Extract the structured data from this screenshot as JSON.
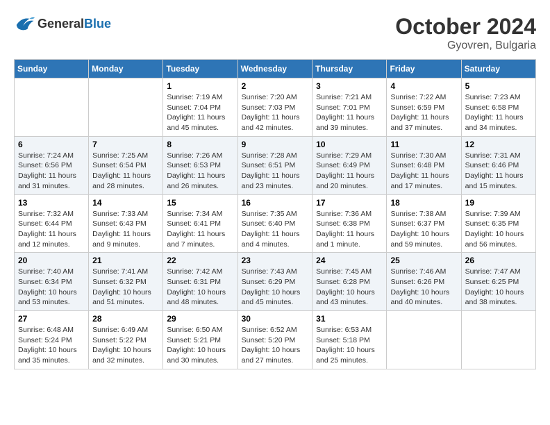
{
  "header": {
    "logo_general": "General",
    "logo_blue": "Blue",
    "month_year": "October 2024",
    "location": "Gyovren, Bulgaria"
  },
  "weekdays": [
    "Sunday",
    "Monday",
    "Tuesday",
    "Wednesday",
    "Thursday",
    "Friday",
    "Saturday"
  ],
  "weeks": [
    [
      {
        "day": "",
        "sunrise": "",
        "sunset": "",
        "daylight": ""
      },
      {
        "day": "",
        "sunrise": "",
        "sunset": "",
        "daylight": ""
      },
      {
        "day": "1",
        "sunrise": "Sunrise: 7:19 AM",
        "sunset": "Sunset: 7:04 PM",
        "daylight": "Daylight: 11 hours and 45 minutes."
      },
      {
        "day": "2",
        "sunrise": "Sunrise: 7:20 AM",
        "sunset": "Sunset: 7:03 PM",
        "daylight": "Daylight: 11 hours and 42 minutes."
      },
      {
        "day": "3",
        "sunrise": "Sunrise: 7:21 AM",
        "sunset": "Sunset: 7:01 PM",
        "daylight": "Daylight: 11 hours and 39 minutes."
      },
      {
        "day": "4",
        "sunrise": "Sunrise: 7:22 AM",
        "sunset": "Sunset: 6:59 PM",
        "daylight": "Daylight: 11 hours and 37 minutes."
      },
      {
        "day": "5",
        "sunrise": "Sunrise: 7:23 AM",
        "sunset": "Sunset: 6:58 PM",
        "daylight": "Daylight: 11 hours and 34 minutes."
      }
    ],
    [
      {
        "day": "6",
        "sunrise": "Sunrise: 7:24 AM",
        "sunset": "Sunset: 6:56 PM",
        "daylight": "Daylight: 11 hours and 31 minutes."
      },
      {
        "day": "7",
        "sunrise": "Sunrise: 7:25 AM",
        "sunset": "Sunset: 6:54 PM",
        "daylight": "Daylight: 11 hours and 28 minutes."
      },
      {
        "day": "8",
        "sunrise": "Sunrise: 7:26 AM",
        "sunset": "Sunset: 6:53 PM",
        "daylight": "Daylight: 11 hours and 26 minutes."
      },
      {
        "day": "9",
        "sunrise": "Sunrise: 7:28 AM",
        "sunset": "Sunset: 6:51 PM",
        "daylight": "Daylight: 11 hours and 23 minutes."
      },
      {
        "day": "10",
        "sunrise": "Sunrise: 7:29 AM",
        "sunset": "Sunset: 6:49 PM",
        "daylight": "Daylight: 11 hours and 20 minutes."
      },
      {
        "day": "11",
        "sunrise": "Sunrise: 7:30 AM",
        "sunset": "Sunset: 6:48 PM",
        "daylight": "Daylight: 11 hours and 17 minutes."
      },
      {
        "day": "12",
        "sunrise": "Sunrise: 7:31 AM",
        "sunset": "Sunset: 6:46 PM",
        "daylight": "Daylight: 11 hours and 15 minutes."
      }
    ],
    [
      {
        "day": "13",
        "sunrise": "Sunrise: 7:32 AM",
        "sunset": "Sunset: 6:44 PM",
        "daylight": "Daylight: 11 hours and 12 minutes."
      },
      {
        "day": "14",
        "sunrise": "Sunrise: 7:33 AM",
        "sunset": "Sunset: 6:43 PM",
        "daylight": "Daylight: 11 hours and 9 minutes."
      },
      {
        "day": "15",
        "sunrise": "Sunrise: 7:34 AM",
        "sunset": "Sunset: 6:41 PM",
        "daylight": "Daylight: 11 hours and 7 minutes."
      },
      {
        "day": "16",
        "sunrise": "Sunrise: 7:35 AM",
        "sunset": "Sunset: 6:40 PM",
        "daylight": "Daylight: 11 hours and 4 minutes."
      },
      {
        "day": "17",
        "sunrise": "Sunrise: 7:36 AM",
        "sunset": "Sunset: 6:38 PM",
        "daylight": "Daylight: 11 hours and 1 minute."
      },
      {
        "day": "18",
        "sunrise": "Sunrise: 7:38 AM",
        "sunset": "Sunset: 6:37 PM",
        "daylight": "Daylight: 10 hours and 59 minutes."
      },
      {
        "day": "19",
        "sunrise": "Sunrise: 7:39 AM",
        "sunset": "Sunset: 6:35 PM",
        "daylight": "Daylight: 10 hours and 56 minutes."
      }
    ],
    [
      {
        "day": "20",
        "sunrise": "Sunrise: 7:40 AM",
        "sunset": "Sunset: 6:34 PM",
        "daylight": "Daylight: 10 hours and 53 minutes."
      },
      {
        "day": "21",
        "sunrise": "Sunrise: 7:41 AM",
        "sunset": "Sunset: 6:32 PM",
        "daylight": "Daylight: 10 hours and 51 minutes."
      },
      {
        "day": "22",
        "sunrise": "Sunrise: 7:42 AM",
        "sunset": "Sunset: 6:31 PM",
        "daylight": "Daylight: 10 hours and 48 minutes."
      },
      {
        "day": "23",
        "sunrise": "Sunrise: 7:43 AM",
        "sunset": "Sunset: 6:29 PM",
        "daylight": "Daylight: 10 hours and 45 minutes."
      },
      {
        "day": "24",
        "sunrise": "Sunrise: 7:45 AM",
        "sunset": "Sunset: 6:28 PM",
        "daylight": "Daylight: 10 hours and 43 minutes."
      },
      {
        "day": "25",
        "sunrise": "Sunrise: 7:46 AM",
        "sunset": "Sunset: 6:26 PM",
        "daylight": "Daylight: 10 hours and 40 minutes."
      },
      {
        "day": "26",
        "sunrise": "Sunrise: 7:47 AM",
        "sunset": "Sunset: 6:25 PM",
        "daylight": "Daylight: 10 hours and 38 minutes."
      }
    ],
    [
      {
        "day": "27",
        "sunrise": "Sunrise: 6:48 AM",
        "sunset": "Sunset: 5:24 PM",
        "daylight": "Daylight: 10 hours and 35 minutes."
      },
      {
        "day": "28",
        "sunrise": "Sunrise: 6:49 AM",
        "sunset": "Sunset: 5:22 PM",
        "daylight": "Daylight: 10 hours and 32 minutes."
      },
      {
        "day": "29",
        "sunrise": "Sunrise: 6:50 AM",
        "sunset": "Sunset: 5:21 PM",
        "daylight": "Daylight: 10 hours and 30 minutes."
      },
      {
        "day": "30",
        "sunrise": "Sunrise: 6:52 AM",
        "sunset": "Sunset: 5:20 PM",
        "daylight": "Daylight: 10 hours and 27 minutes."
      },
      {
        "day": "31",
        "sunrise": "Sunrise: 6:53 AM",
        "sunset": "Sunset: 5:18 PM",
        "daylight": "Daylight: 10 hours and 25 minutes."
      },
      {
        "day": "",
        "sunrise": "",
        "sunset": "",
        "daylight": ""
      },
      {
        "day": "",
        "sunrise": "",
        "sunset": "",
        "daylight": ""
      }
    ]
  ]
}
